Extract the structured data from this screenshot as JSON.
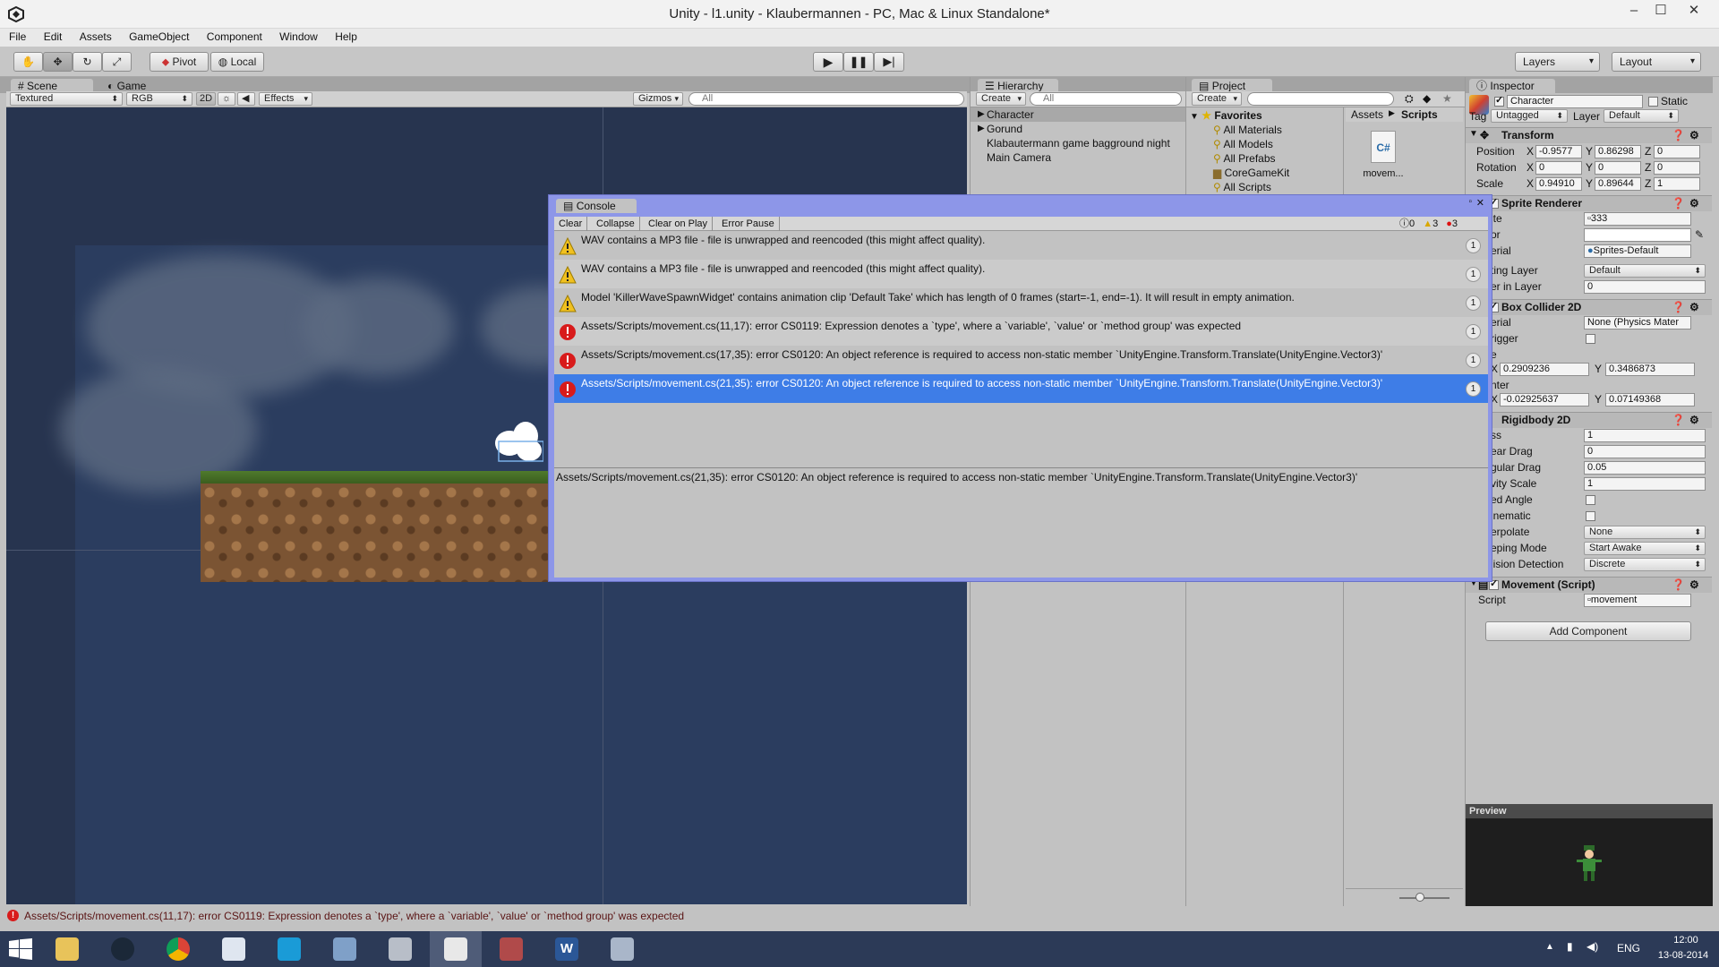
{
  "window": {
    "title": "Unity - l1.unity - Klaubermannen - PC, Mac & Linux Standalone*",
    "minimize": "–",
    "maximize": "☐",
    "close": "✕"
  },
  "menu": [
    "File",
    "Edit",
    "Assets",
    "GameObject",
    "Component",
    "Window",
    "Help"
  ],
  "toolbar": {
    "pivot": "Pivot",
    "local": "Local",
    "layers": "Layers",
    "layout": "Layout"
  },
  "scene": {
    "tab_scene": "Scene",
    "tab_game": "Game",
    "render_mode": "Textured",
    "color_mode": "RGB",
    "mode_2d": "2D",
    "effects": "Effects",
    "gizmos": "Gizmos",
    "search_placeholder": "All"
  },
  "hierarchy": {
    "tab": "Hierarchy",
    "create": "Create",
    "search_placeholder": "All",
    "items": [
      "Character",
      "Gorund",
      "Klabautermann game bagground night",
      "Main Camera"
    ]
  },
  "project": {
    "tab": "Project",
    "create": "Create",
    "favorites_label": "Favorites",
    "favorites": [
      "All Materials",
      "All Models",
      "All Prefabs",
      "CoreGameKit",
      "All Scripts"
    ],
    "breadcrumb_root": "Assets",
    "breadcrumb_current": "Scripts",
    "asset_name": "movem..."
  },
  "console": {
    "tab": "Console",
    "clear": "Clear",
    "collapse": "Collapse",
    "clear_on_play": "Clear on Play",
    "error_pause": "Error Pause",
    "info_count": "0",
    "warn_count": "3",
    "error_count": "3",
    "entries": [
      {
        "type": "warning",
        "text": "WAV contains a MP3 file - file is unwrapped and reencoded (this might affect quality).",
        "count": "1"
      },
      {
        "type": "warning",
        "text": "WAV contains a MP3 file - file is unwrapped and reencoded (this might affect quality).",
        "count": "1"
      },
      {
        "type": "warning",
        "text": "Model 'KillerWaveSpawnWidget' contains animation clip 'Default Take' which has length of 0 frames (start=-1, end=-1). It will result in empty animation.",
        "count": "1"
      },
      {
        "type": "error",
        "text": "Assets/Scripts/movement.cs(11,17): error CS0119: Expression denotes a `type', where a `variable', `value' or `method group' was expected",
        "count": "1"
      },
      {
        "type": "error",
        "text": "Assets/Scripts/movement.cs(17,35): error CS0120: An object reference is required to access non-static member `UnityEngine.Transform.Translate(UnityEngine.Vector3)'",
        "count": "1"
      },
      {
        "type": "error",
        "text": "Assets/Scripts/movement.cs(21,35): error CS0120: An object reference is required to access non-static member `UnityEngine.Transform.Translate(UnityEngine.Vector3)'",
        "count": "1"
      }
    ],
    "detail": "Assets/Scripts/movement.cs(21,35): error CS0120: An object reference is required to access non-static member `UnityEngine.Transform.Translate(UnityEngine.Vector3)'"
  },
  "inspector": {
    "tab": "Inspector",
    "object_name": "Character",
    "static_label": "Static",
    "tag_label": "Tag",
    "tag_value": "Untagged",
    "layer_label": "Layer",
    "layer_value": "Default",
    "transform": {
      "title": "Transform",
      "position_label": "Position",
      "pos_x": "-0.9577",
      "pos_y": "0.86298",
      "pos_z": "0",
      "rotation_label": "Rotation",
      "rot_x": "0",
      "rot_y": "0",
      "rot_z": "0",
      "scale_label": "Scale",
      "scale_x": "0.94910",
      "scale_y": "0.89644",
      "scale_z": "1"
    },
    "sprite_renderer": {
      "title": "Sprite Renderer",
      "sprite_label": "ite",
      "sprite_value": "333",
      "color_label": "or",
      "material_label": "erial",
      "material_value": "Sprites-Default",
      "sorting_layer_label": "ting Layer",
      "sorting_layer_value": "Default",
      "order_label": "er in Layer",
      "order_value": "0"
    },
    "box_collider": {
      "title": "Box Collider 2D",
      "material_label": "erial",
      "material_value": "None (Physics Mater",
      "trigger_label": "rigger",
      "size_label": "e",
      "size_x": "0.2909236",
      "size_y": "0.3486873",
      "center_label": "nter",
      "center_x": "-0.02925637",
      "center_y": "0.07149368"
    },
    "rigidbody": {
      "title": "Rigidbody 2D",
      "mass_label": "ss",
      "mass_value": "1",
      "linear_drag_label": "ear Drag",
      "linear_drag_value": "0",
      "angular_drag_label": "gular Drag",
      "angular_drag_value": "0.05",
      "gravity_label": "vity Scale",
      "gravity_value": "1",
      "fixed_angle_label": "ed Angle",
      "kinematic_label": "inematic",
      "interpolate_label": "erpolate",
      "interpolate_value": "None",
      "sleeping_label": "eping Mode",
      "sleeping_value": "Start Awake",
      "collision_label": "lision Detection",
      "collision_value": "Discrete"
    },
    "movement": {
      "title": "Movement (Script)",
      "script_label": "Script",
      "script_value": "movement"
    },
    "add_component": "Add Component",
    "preview": "Preview"
  },
  "status": {
    "message": "Assets/Scripts/movement.cs(11,17): error CS0119: Expression denotes a `type', where a `variable', `value' or `method group' was expected"
  },
  "taskbar": {
    "lang": "ENG",
    "time": "12:00",
    "date": "13-08-2014"
  },
  "colors": {
    "selection": "#3e7de7",
    "console_frame": "#8d96e8",
    "scene_bg": "#27344f",
    "taskbar": "#2c3a57"
  }
}
